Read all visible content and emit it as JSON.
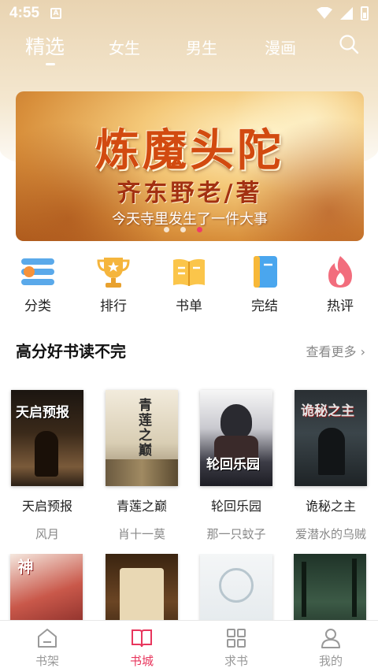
{
  "status_bar": {
    "time": "4:55",
    "indicator": "A"
  },
  "top_tabs": [
    {
      "label": "精选",
      "active": true
    },
    {
      "label": "女生",
      "active": false
    },
    {
      "label": "男生",
      "active": false
    },
    {
      "label": "漫画",
      "active": false
    }
  ],
  "banner": {
    "title": "炼魔头陀",
    "author": "齐东野老/著",
    "tagline": "今天寺里发生了一件大事",
    "slide_count": 3,
    "active_slide": 3
  },
  "quick_nav": [
    {
      "label": "分类",
      "icon": "category-icon"
    },
    {
      "label": "排行",
      "icon": "trophy-icon"
    },
    {
      "label": "书单",
      "icon": "open-book-icon"
    },
    {
      "label": "完结",
      "icon": "finished-book-icon"
    },
    {
      "label": "热评",
      "icon": "flame-icon"
    }
  ],
  "section": {
    "title": "高分好书读不完",
    "more": "查看更多 ›"
  },
  "books": [
    {
      "title": "天启预报",
      "author": "风月",
      "cover_text": "天启预报"
    },
    {
      "title": "青莲之巅",
      "author": "肖十一莫",
      "cover_text": "青莲之巅"
    },
    {
      "title": "轮回乐园",
      "author": "那一只蚊子",
      "cover_text": "轮回乐园"
    },
    {
      "title": "诡秘之主",
      "author": "爱潜水的乌贼",
      "cover_text": "诡秘之主"
    }
  ],
  "bottom_nav": [
    {
      "label": "书架",
      "icon": "bookshelf-icon",
      "active": false
    },
    {
      "label": "书城",
      "icon": "bookstore-icon",
      "active": true
    },
    {
      "label": "求书",
      "icon": "grid-icon",
      "active": false
    },
    {
      "label": "我的",
      "icon": "profile-icon",
      "active": false
    }
  ],
  "colors": {
    "accent": "#e8365d",
    "header_bg": "#e9d4b2",
    "muted_text": "#888888"
  }
}
